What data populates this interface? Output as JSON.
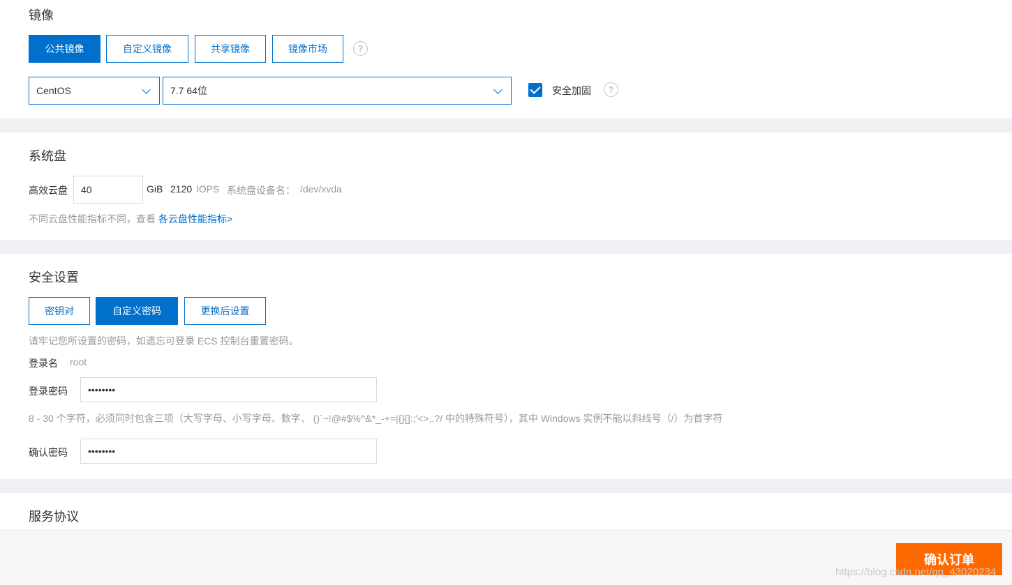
{
  "image_section": {
    "title": "镜像",
    "tabs": [
      {
        "label": "公共镜像",
        "active": true
      },
      {
        "label": "自定义镜像",
        "active": false
      },
      {
        "label": "共享镜像",
        "active": false
      },
      {
        "label": "镜像市场",
        "active": false
      }
    ],
    "help": "?",
    "os_select": "CentOS",
    "version_select": "7.7 64位",
    "security_harden": {
      "checked": true,
      "label": "安全加固"
    }
  },
  "disk_section": {
    "title": "系统盘",
    "disk_type": "高效云盘",
    "size_value": "40",
    "size_unit": "GiB",
    "iops_value": "2120",
    "iops_unit": "IOPS",
    "device_label": "系统盘设备名：",
    "device_name": "/dev/xvda",
    "note_prefix": "不同云盘性能指标不同，查看",
    "note_link": "各云盘性能指标>"
  },
  "security_section": {
    "title": "安全设置",
    "tabs": [
      {
        "label": "密钥对",
        "active": false
      },
      {
        "label": "自定义密码",
        "active": true
      },
      {
        "label": "更换后设置",
        "active": false
      }
    ],
    "hint": "请牢记您所设置的密码，如遗忘可登录 ECS 控制台重置密码。",
    "login_name_label": "登录名",
    "login_name_value": "root",
    "password_label": "登录密码",
    "password_value": "••••••••",
    "password_rule": "8 - 30 个字符，必须同时包含三项（大写字母、小写字母、数字、 ()`~!@#$%^&*_-+=|{}[]:;'<>,.?/ 中的特殊符号），其中 Windows 实例不能以斜线号（/）为首字符",
    "confirm_label": "确认密码",
    "confirm_value": "••••••••"
  },
  "agreement_section": {
    "title": "服务协议"
  },
  "footer": {
    "confirm_button": "确认订单",
    "watermark": "https://blog.csdn.net/qq_43020234"
  },
  "colors": {
    "primary": "#0070cc",
    "accent": "#ff6a00",
    "background": "#eff0f4"
  }
}
